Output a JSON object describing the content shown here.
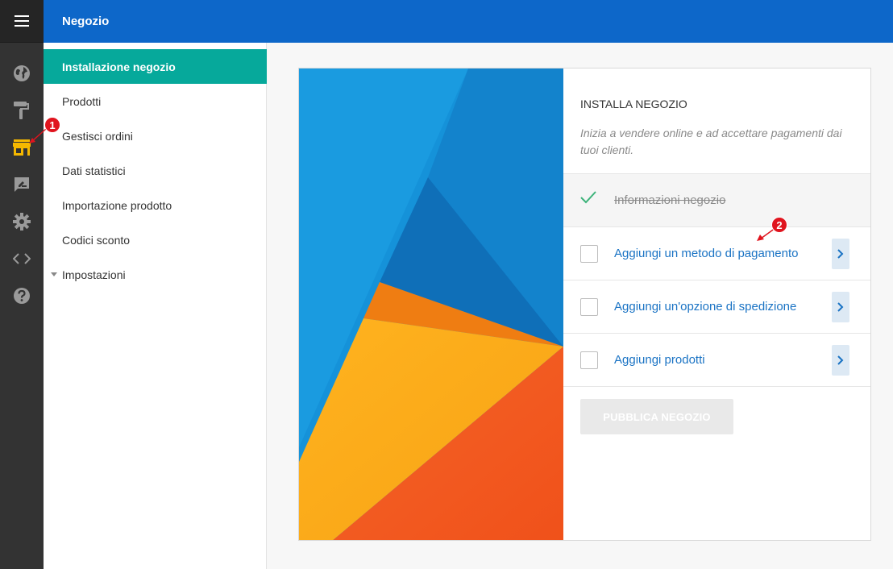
{
  "header": {
    "title": "Negozio"
  },
  "rail": {
    "icons": [
      "menu-icon",
      "globe-icon",
      "paint-roller-icon",
      "store-icon",
      "edit-note-icon",
      "gear-icon",
      "code-icon",
      "help-icon"
    ],
    "active_color": "#f5b800"
  },
  "subnav": {
    "items": [
      {
        "label": "Installazione negozio"
      },
      {
        "label": "Prodotti"
      },
      {
        "label": "Gestisci ordini"
      },
      {
        "label": "Dati statistici"
      },
      {
        "label": "Importazione prodotto"
      },
      {
        "label": "Codici sconto"
      },
      {
        "label": "Impostazioni"
      }
    ]
  },
  "panel": {
    "title": "INSTALLA NEGOZIO",
    "description": "Inizia a vendere online e ad accettare pagamenti dai tuoi clienti.",
    "steps": [
      {
        "label": "Informazioni negozio",
        "done": true
      },
      {
        "label": "Aggiungi un metodo di pagamento",
        "done": false
      },
      {
        "label": "Aggiungi un'opzione di spedizione",
        "done": false
      },
      {
        "label": "Aggiungi prodotti",
        "done": false
      }
    ],
    "publish_label": "PUBBLICA NEGOZIO"
  },
  "annotations": {
    "callout_1": "1",
    "callout_2": "2"
  },
  "colors": {
    "header": "#0d67c9",
    "rail": "#333333",
    "active_nav": "#06a99b",
    "link": "#1a73c4",
    "check": "#3db37a"
  }
}
